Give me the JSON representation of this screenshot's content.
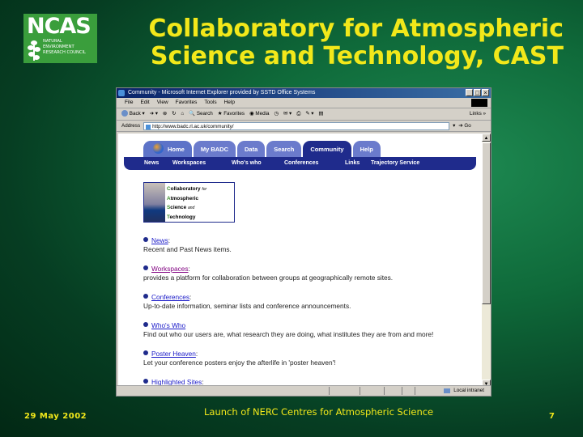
{
  "slide": {
    "logo": {
      "acronym": "NCAS",
      "lines": [
        "NATURAL",
        "ENVIRONMENT",
        "RESEARCH COUNCIL"
      ]
    },
    "title_line1": "Collaboratory for Atmospheric",
    "title_line2": "Science and Technology, CAST",
    "footer_date": "29 May 2002",
    "footer_center": "Launch of NERC Centres for Atmospheric Science",
    "page_number": "7",
    "colors": {
      "title": "#f2e81a",
      "background": "#0f6a3a"
    }
  },
  "browser": {
    "title": "Community - Microsoft Internet Explorer provided by SSTD Office Systems",
    "window_buttons": [
      "_",
      "□",
      "×"
    ],
    "menu": [
      "File",
      "Edit",
      "View",
      "Favorites",
      "Tools",
      "Help"
    ],
    "toolbar": {
      "back": "Back",
      "search": "Search",
      "favorites": "Favorites",
      "media": "Media",
      "links": "Links"
    },
    "address_label": "Address",
    "address_value": "http://www.badc.rl.ac.uk/community/",
    "go": "Go",
    "status_zone": "Local intranet"
  },
  "site": {
    "tabs": [
      "Home",
      "My BADC",
      "Data",
      "Search",
      "Community",
      "Help"
    ],
    "active_tab": "Community",
    "subnav": [
      "News",
      "Workspaces",
      "Who's who",
      "Conferences",
      "Links",
      "Trajectory Service"
    ],
    "cast_logo": {
      "line1_first": "C",
      "line1_rest": "ollaboratory",
      "line1_small": "for",
      "line2_first": "A",
      "line2_rest": "tmospheric",
      "line3_first": "S",
      "line3_rest": "cience",
      "line3_small": "and",
      "line4_first": "T",
      "line4_rest": "echnology"
    },
    "items": [
      {
        "link": "News",
        "desc": "Recent and Past News items."
      },
      {
        "link": "Workspaces",
        "desc": "provides a platform for collaboration between groups at geographically remote sites."
      },
      {
        "link": "Conferences",
        "desc": "Up-to-date information, seminar lists and conference announcements."
      },
      {
        "link": "Who's Who",
        "desc": "Find out who our users are, what research they are doing, what institutes they are from and more!"
      },
      {
        "link": "Poster Heaven",
        "desc": "Let your conference posters enjoy the afterlife in 'poster heaven'!"
      },
      {
        "link": "Highlighted Sites",
        "desc": ""
      }
    ]
  }
}
